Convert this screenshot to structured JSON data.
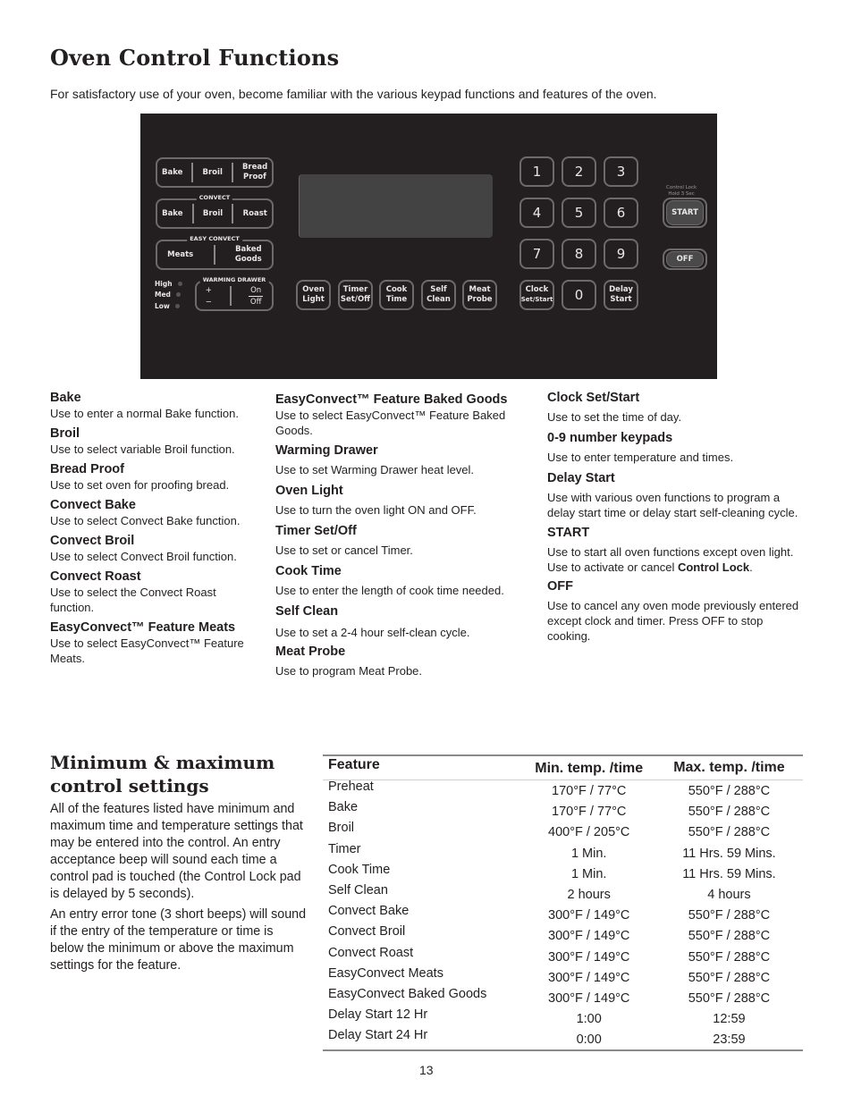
{
  "page": {
    "title": "Oven Control Functions",
    "intro": "For satisfactory use of your oven, become familiar with the various keypad functions and features of the oven.",
    "page_number": "13"
  },
  "panel": {
    "bake_group": [
      "Bake",
      "Broil",
      "Bread Proof"
    ],
    "convect_label": "CONVECT",
    "convect_group": [
      "Bake",
      "Broil",
      "Roast"
    ],
    "easy_convect_label": "EASY CONVECT",
    "easy_convect_group": [
      "Meats",
      "Baked Goods"
    ],
    "warming_drawer_label": "WARMING DRAWER",
    "warming_levels": [
      "High",
      "Med",
      "Low"
    ],
    "warming_plus": "+",
    "warming_minus": "−",
    "warming_on": "On",
    "warming_off": "Off",
    "function_keys": [
      "Oven Light",
      "Timer Set/Off",
      "Cook Time",
      "Self Clean",
      "Meat Probe"
    ],
    "number_keys": [
      "1",
      "2",
      "3",
      "4",
      "5",
      "6",
      "7",
      "8",
      "9"
    ],
    "clock_key_top": "Clock",
    "clock_key_bottom": "Set/Start",
    "zero_key": "0",
    "delay_key": "Delay Start",
    "control_lock_label_1": "Control Lock",
    "control_lock_label_2": "Hold 3 Sec",
    "start_key": "START",
    "off_key": "OFF"
  },
  "descriptions": {
    "col1": [
      {
        "title": "Bake",
        "text": "Use to enter a normal Bake function."
      },
      {
        "title": "Broil",
        "text": "Use to select variable Broil function."
      },
      {
        "title": "Bread Proof",
        "text": "Use to set oven for proofing bread."
      },
      {
        "title": "Convect Bake",
        "text": "Use to select Convect  Bake function."
      },
      {
        "title": "Convect Broil",
        "text": "Use to select Convect  Broil function."
      },
      {
        "title": "Convect Roast",
        "text": "Use to select the Convect  Roast function."
      },
      {
        "title": "EasyConvect™ Feature Meats",
        "text": "Use to select EasyConvect™ Feature Meats."
      }
    ],
    "col2": [
      {
        "title": "EasyConvect™ Feature Baked Goods",
        "text": "Use to select EasyConvect™ Feature Baked Goods."
      },
      {
        "title": "Warming  Drawer",
        "text": "Use to set Warming Drawer heat level."
      },
      {
        "title": "Oven Light",
        "text": "Use to turn the oven light ON and OFF."
      },
      {
        "title": "Timer Set/Off",
        "text": "Use to set or cancel Timer."
      },
      {
        "title": "Cook Time",
        "text": "Use to enter the length of cook time needed."
      },
      {
        "title": "Self  Clean",
        "text": "Use to set a 2-4 hour self-clean cycle."
      },
      {
        "title": "Meat  Probe",
        "text": "Use to program Meat Probe."
      }
    ],
    "col3": [
      {
        "title": "Clock Set/Start",
        "text": "Use  to set the time of day."
      },
      {
        "title": "0-9 number keypads",
        "text": "Use to enter temperature and times."
      },
      {
        "title": "Delay Start",
        "text": "Use with various oven functions to program a delay start time or delay start self-cleaning cycle."
      },
      {
        "title": "START",
        "text": "Use to start all oven functions except oven light. Use to activate or cancel ",
        "text_bold": "Control Lock",
        "text_end": "."
      },
      {
        "title": "OFF",
        "text": "Use to cancel any oven mode previously entered except clock and timer. Press OFF to stop cooking."
      }
    ]
  },
  "minmax": {
    "title_line1": "Minimum  &  maximum",
    "title_line2": "control  settings",
    "para1": "All of the features listed have minimum and maximum time and temperature settings that may be entered into the control.  An entry acceptance beep will sound each time a control pad is touched (the Control Lock pad is delayed by 5 seconds).",
    "para2": "An entry error tone (3 short beeps) will sound if the entry of the temperature or time is below the minimum or above the maximum settings for the feature.",
    "headers": [
      "Feature",
      "Min. temp. /time",
      "Max. temp. /time"
    ],
    "rows": [
      [
        "Preheat",
        "170°F / 77°C",
        "550°F / 288°C"
      ],
      [
        "Bake",
        "170°F / 77°C",
        "550°F / 288°C"
      ],
      [
        "Broil",
        "400°F / 205°C",
        "550°F / 288°C"
      ],
      [
        "Timer",
        "1 Min.",
        "11 Hrs. 59 Mins."
      ],
      [
        "Cook Time",
        "1 Min.",
        "11 Hrs. 59 Mins."
      ],
      [
        "Self Clean",
        "2 hours",
        "4 hours"
      ],
      [
        "Convect Bake",
        "300°F / 149°C",
        "550°F / 288°C"
      ],
      [
        "Convect Broil",
        "300°F / 149°C",
        "550°F / 288°C"
      ],
      [
        "Convect Roast",
        "300°F / 149°C",
        "550°F / 288°C"
      ],
      [
        "EasyConvect Meats",
        "300°F / 149°C",
        "550°F / 288°C"
      ],
      [
        "EasyConvect Baked Goods",
        "300°F / 149°C",
        "550°F / 288°C"
      ],
      [
        "Delay Start 12 Hr",
        "1:00",
        "12:59"
      ],
      [
        "Delay Start 24 Hr",
        "0:00",
        "23:59"
      ]
    ]
  }
}
